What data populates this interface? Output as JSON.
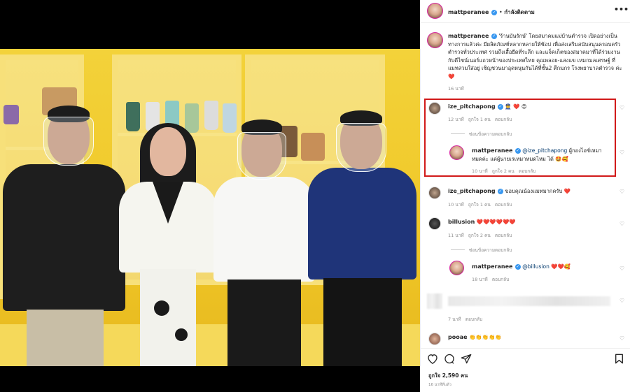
{
  "post": {
    "author": "mattperanee",
    "follow_status": "กำลังติดตาม",
    "caption": "'ร้านบันรักษ์' โดยสมาคมแม่บ้านตำรวจ เปิดอย่างเป็นทางการแล้วค่ะ มีผลิตภัณฑ์หลากหลายให้ช้อป เพื่อส่งเสริมสนับสนุนครอบครัวตำรวจทั่วประเทศ รวมถึงเสื้อยืดที่ระลึก และแจ็คเก็ตของสมาคมาที่ได้ร่วมงานกับดีไซน์เนอร์แถวหน้าของประเทศไทย คุณพลอย-แสงแข เหมกมลเศรษฐ์ ที่แมทสวมใส่อยู่ เชิญชวนมาอุดหนุนกันได้ที่ชั้น2 ตึกมภร โรงพยาบาลตำรวจ ค่ะ",
    "caption_emoji": "❤️",
    "caption_time": "16 นาที",
    "likes": "ถูกใจ 2,590 คน",
    "time_ago": "16 นาทีที่แล้ว",
    "more_icon": "more-horizontal-icon"
  },
  "comments": [
    {
      "user": "ize_pitchapong",
      "text": "👮 ❤️ 😍",
      "time": "12 นาที",
      "likes": "ถูกใจ 1 คน",
      "reply": "ตอบกลับ",
      "hide_replies": "ซ่อนข้อความตอบกลับ",
      "replies": [
        {
          "user": "mattperanee",
          "mention": "@ize_pitchapong",
          "text": "ผู้กองไอซ์เหมาหมดค่ะ แค่ผู้นายเรเหมาหมดไหม ได้ 🤩🥰",
          "time": "10 นาที",
          "likes": "ถูกใจ 2 คน",
          "reply": "ตอบกลับ"
        }
      ]
    },
    {
      "user": "ize_pitchapong",
      "text": "ขอบคุณน้องแมทมากครับ ❤️",
      "time": "10 นาที",
      "likes": "ถูกใจ 1 คน",
      "reply": "ตอบกลับ"
    },
    {
      "user": "billusion",
      "text": "❤️❤️❤️❤️❤️❤️",
      "time": "11 นาที",
      "likes": "ถูกใจ 2 คน",
      "reply": "ตอบกลับ",
      "hide_replies": "ซ่อนข้อความตอบกลับ",
      "replies": [
        {
          "user": "mattperanee",
          "mention": "@billusion",
          "text": "❤️❤️🥰",
          "time": "18 นาที",
          "reply": "ตอบกลับ"
        }
      ]
    },
    {
      "user": "",
      "text": "",
      "time": "7 นาที",
      "reply": "ตอบกลับ"
    },
    {
      "user": "pooae",
      "text": "👏👏👏👏👏"
    }
  ],
  "action_icons": [
    "heart-icon",
    "comment-icon",
    "share-icon",
    "bookmark-icon"
  ],
  "colors": {
    "highlight_border": "#d11a1a",
    "verified": "#3897f0",
    "heart_red": "#ed4956",
    "backdrop_yellow": "#f0c727"
  }
}
